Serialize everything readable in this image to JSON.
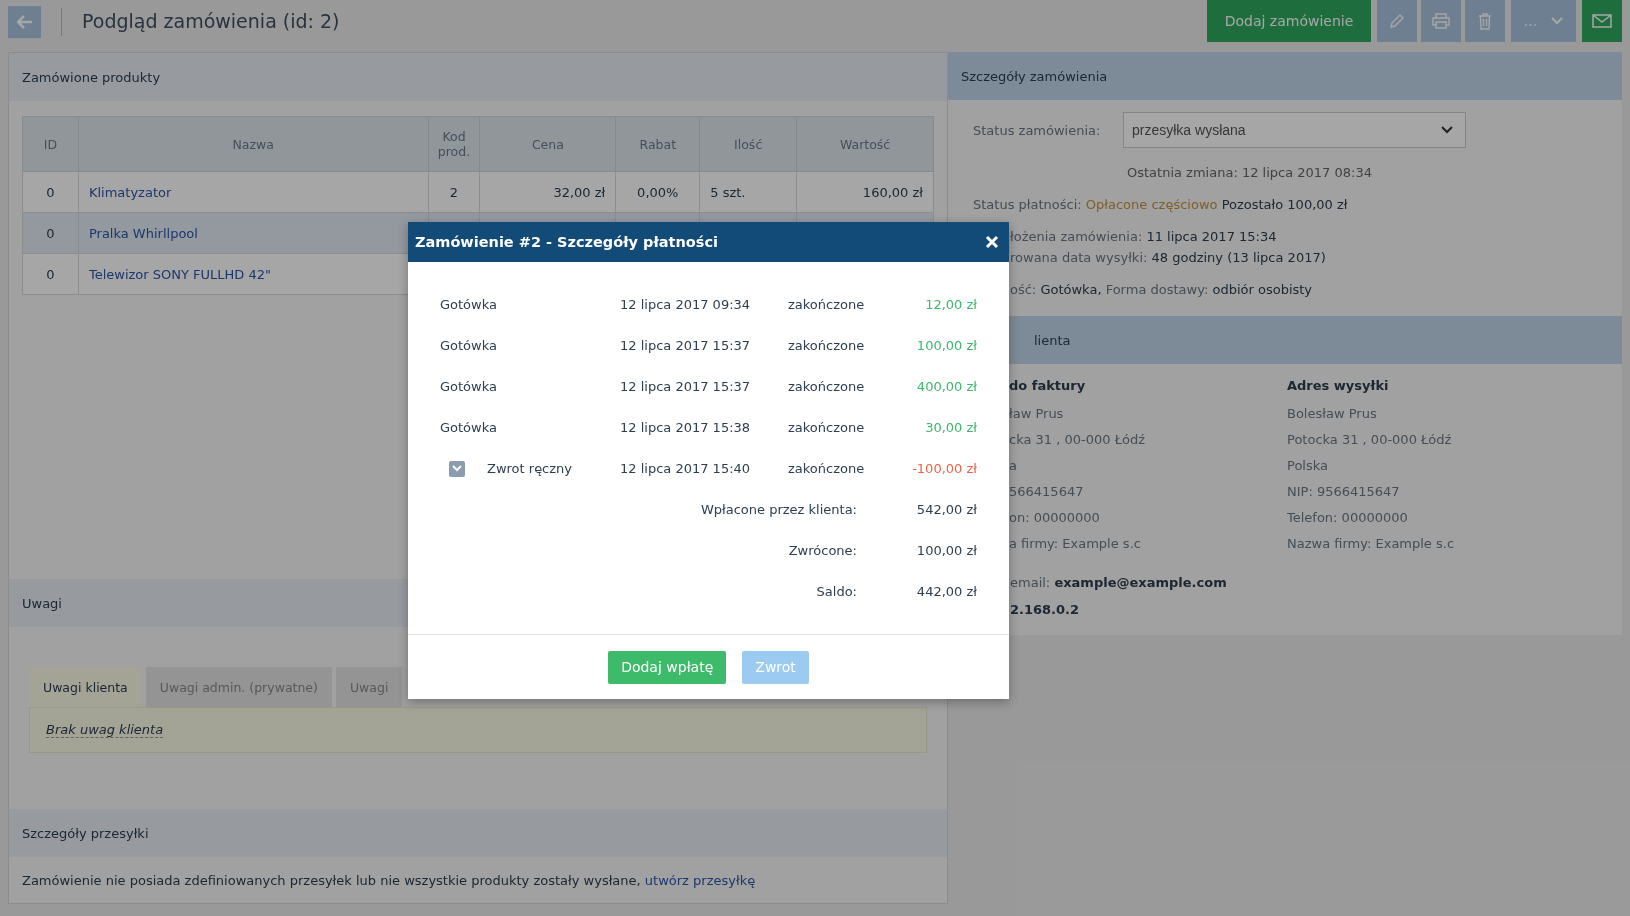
{
  "header": {
    "title": "Podgląd zamówienia (id: 2)",
    "add_label": "Dodaj zamówienie",
    "more_label": "..."
  },
  "products": {
    "title": "Zamówione produkty",
    "columns": [
      "ID",
      "Nazwa",
      "Kod prod.",
      "Cena",
      "Rabat",
      "Ilość",
      "Wartość"
    ],
    "rows": [
      {
        "cells": [
          "0",
          "Klimatyzator",
          "2",
          "32,00 zł",
          "0,00%",
          "5 szt.",
          "160,00 zł"
        ]
      },
      {
        "cells": [
          "0",
          "Pralka Whirllpool"
        ]
      },
      {
        "cells": [
          "0",
          "Telewizor SONY FULLHD 42\""
        ]
      }
    ]
  },
  "notes": {
    "title": "Uwagi",
    "tabs": [
      {
        "label": "Uwagi klienta",
        "selected": true
      },
      {
        "label": "Uwagi admin. (prywatne)",
        "selected": false
      },
      {
        "label": "Uwagi",
        "selected": false
      }
    ],
    "empty_text": "Brak uwag klienta"
  },
  "shipment": {
    "title": "Szczegóły przesyłki",
    "text": "Zamówienie nie posiada zdefiniowanych przesyłek lub nie wszystkie produkty zostały wysłane,",
    "link": "utwórz przesyłkę"
  },
  "order_details": {
    "title": "Szczegóły zamówienia",
    "status_label": "Status zamówienia:",
    "status_value": "przesyłka wysłana",
    "last_change": "Ostatnia zmiana: 12 lipca 2017 08:34",
    "lines": [
      {
        "parts": [
          {
            "kind": "label",
            "text": "Status płatności:"
          },
          {
            "kind": "warning",
            "text": "Opłacone częściowo"
          },
          {
            "kind": "value",
            "text": "Pozostało 100,00 zł"
          }
        ]
      },
      {
        "parts": [
          {
            "kind": "label",
            "text": "łożenia zamówienia:"
          },
          {
            "kind": "value",
            "text": "11 lipca 2017 15:34"
          }
        ]
      },
      {
        "parts": [
          {
            "kind": "label",
            "text": "rowana data wysyłki:"
          },
          {
            "kind": "value",
            "text": "48 godziny (13 lipca 2017)"
          }
        ]
      },
      {
        "parts": [
          {
            "kind": "label",
            "text": "ość:"
          },
          {
            "kind": "value",
            "text": "Gotówka,"
          },
          {
            "kind": "label",
            "text": "Forma dostawy:"
          },
          {
            "kind": "value",
            "text": "odbiór osobisty"
          }
        ]
      }
    ]
  },
  "client": {
    "title": "lienta",
    "addresses": [
      {
        "heading": "do faktury",
        "lines": [
          "ław Prus",
          "cka 31 , 00-000 Łódź",
          "a",
          "566415647",
          "on: 00000000",
          "a firmy: Example s.c"
        ]
      },
      {
        "heading": "Adres wysyłki",
        "lines": [
          "Bolesław Prus",
          "Potocka 31 , 00-000 Łódź",
          "Polska",
          "NIP: 9566415647",
          "Telefon: 00000000",
          "Nazwa firmy: Example s.c"
        ]
      }
    ],
    "contact": [
      {
        "parts": [
          {
            "kind": "label",
            "text": "email:"
          },
          {
            "kind": "bold",
            "text": "example@example.com"
          }
        ]
      },
      {
        "parts": [
          {
            "kind": "bold",
            "text": "2.168.0.2"
          }
        ]
      }
    ]
  },
  "modal": {
    "title": "Zamówienie #2 - Szczegóły płatności",
    "payments": [
      {
        "kind": "payment",
        "method": "Gotówka",
        "date": "12 lipca 2017 09:34",
        "status": "zakończone",
        "amount": "12,00 zł"
      },
      {
        "kind": "payment",
        "method": "Gotówka",
        "date": "12 lipca 2017 15:37",
        "status": "zakończone",
        "amount": "100,00 zł"
      },
      {
        "kind": "payment",
        "method": "Gotówka",
        "date": "12 lipca 2017 15:37",
        "status": "zakończone",
        "amount": "400,00 zł"
      },
      {
        "kind": "payment",
        "method": "Gotówka",
        "date": "12 lipca 2017 15:38",
        "status": "zakończone",
        "amount": "30,00 zł"
      },
      {
        "kind": "refund",
        "method": "Zwrot ręczny",
        "date": "12 lipca 2017 15:40",
        "status": "zakończone",
        "amount": "-100,00 zł"
      }
    ],
    "summary": [
      {
        "label": "Wpłacone przez klienta:",
        "value": "542,00 zł"
      },
      {
        "label": "Zwrócone:",
        "value": "100,00 zł"
      },
      {
        "label": "Saldo:",
        "value": "442,00 zł"
      }
    ],
    "buttons": [
      {
        "label": "Dodaj wpłatę",
        "disabled": false
      },
      {
        "label": "Zwrot",
        "disabled": true
      }
    ]
  }
}
